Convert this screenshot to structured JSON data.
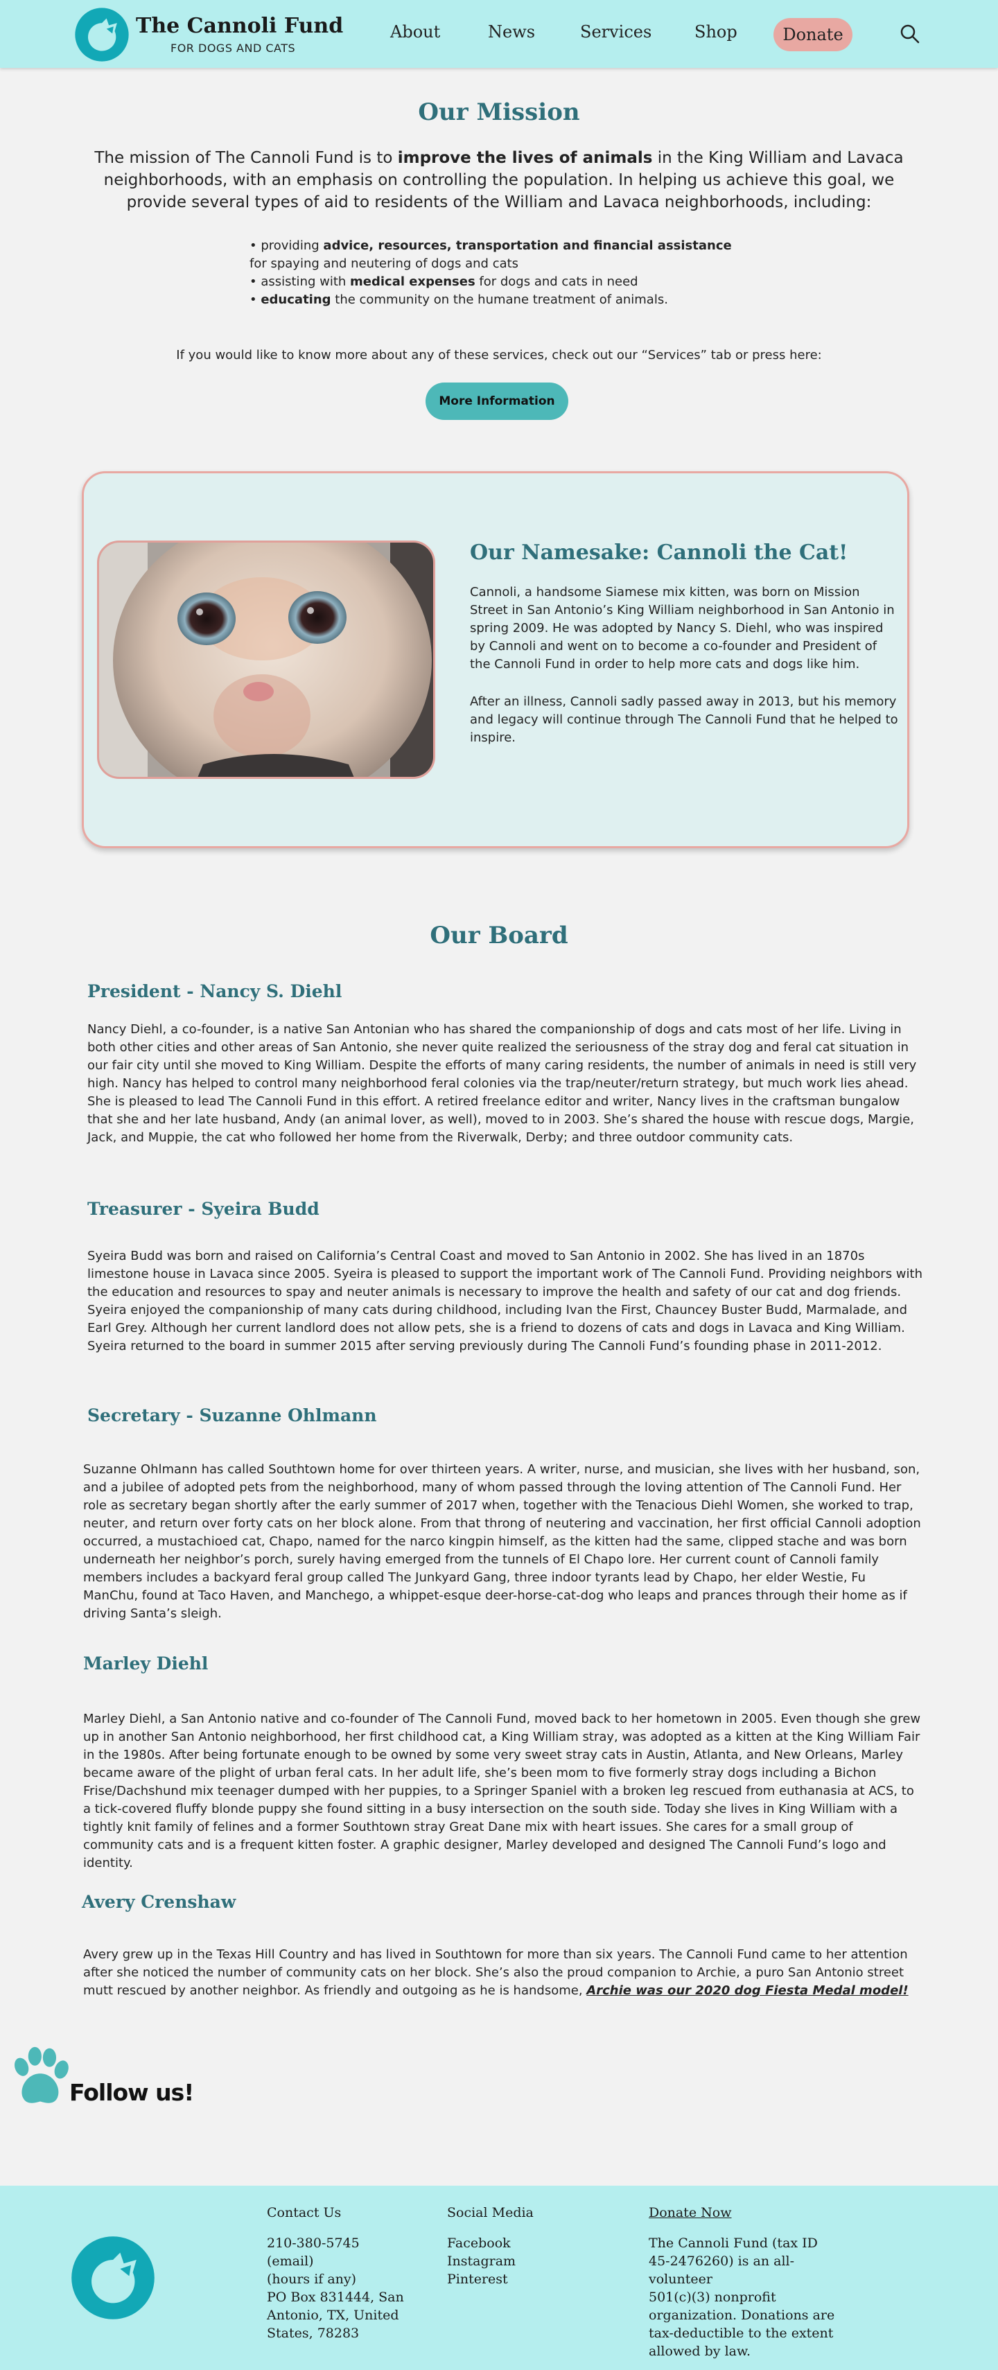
{
  "header": {
    "brand_title": "The Cannoli Fund",
    "brand_subtitle": "FOR DOGS AND CATS",
    "nav": [
      "About",
      "News",
      "Services",
      "Shop"
    ],
    "donate_label": "Donate",
    "search_icon": "search-icon"
  },
  "mission": {
    "title": "Our Mission",
    "intro_pre": "The mission of The Cannoli Fund is to ",
    "intro_bold": "improve the lives of animals",
    "intro_post": " in the King William and Lavaca neighborhoods, with an emphasis on controlling the population. In helping us achieve this goal, we provide several types of aid to residents of the William and Lavaca neighborhoods, including:",
    "items": [
      {
        "pre": "• providing ",
        "bold": "advice, resources, transportation and financial assistance",
        "post": " for spaying and neutering of dogs and cats"
      },
      {
        "pre": "• assisting with ",
        "bold": "medical expenses",
        "post": " for dogs and cats in need"
      },
      {
        "pre": "• ",
        "bold": "educating",
        "post": " the community on the humane treatment of animals."
      }
    ],
    "cta_text": "If you would like to know more about any of these services, check out our “Services” tab or press here:",
    "button_label": "More Information"
  },
  "namesake": {
    "title": "Our Namesake: Cannoli the Cat!",
    "paragraph_1": "Cannoli, a handsome Siamese mix kitten, was born on Mission Street in San Antonio’s King William neighborhood in San Antonio in spring 2009. He was adopted by Nancy S. Diehl, who was inspired by Cannoli and went on to become a co-founder and President of the Cannoli Fund in order to help more cats and dogs like him.",
    "paragraph_2": "After an illness, Cannoli sadly passed away in 2013, but his memory and legacy will continue through The Cannoli Fund that he helped to inspire."
  },
  "board": {
    "title": "Our Board",
    "members": [
      {
        "name": "President - Nancy S. Diehl",
        "bio": "Nancy Diehl, a co-founder, is a native San Antonian who has shared the companionship of dogs and cats most of her life. Living in both other cities and other areas of San Antonio, she never quite realized the seriousness of the stray dog and feral cat situation in our fair city until she moved to King William. Despite the efforts of many caring residents, the number of animals in need is still very high. Nancy has helped to control many neighborhood feral colonies via the trap/neuter/return strategy, but much work lies ahead. She is pleased to lead The Cannoli Fund in this effort. A retired freelance editor and writer, Nancy lives in the craftsman bungalow that she and her late husband, Andy (an animal lover, as well), moved to in 2003. She’s shared the house with rescue dogs, Margie,  Jack, and Muppie, the cat who followed her home from the Riverwalk, Derby; and three outdoor community cats."
      },
      {
        "name": "Treasurer - Syeira Budd",
        "bio": "Syeira Budd was born and raised on California’s Central Coast and moved to San Antonio in 2002. She has lived in an 1870s limestone house in Lavaca since 2005. Syeira is pleased to support the important work of The Cannoli Fund. Providing neighbors with the education and resources to spay and neuter animals is necessary to improve the health and safety of our cat and dog friends. Syeira enjoyed the companionship of many cats during childhood, including Ivan the First, Chauncey Buster Budd, Marmalade, and Earl Grey. Although her current landlord does not allow pets, she is a friend to dozens of cats and dogs in Lavaca and King William. Syeira returned to the board in summer 2015 after serving previously during The Cannoli Fund’s founding phase in 2011-2012."
      },
      {
        "name": "Secretary - Suzanne Ohlmann",
        "bio": "Suzanne Ohlmann has called Southtown home for over thirteen years. A writer, nurse, and musician, she lives with her husband, son, and a jubilee of adopted pets from the neighborhood, many of whom passed through the loving attention of The Cannoli Fund. Her role as secretary began shortly after the early summer of 2017 when, together with the Tenacious Diehl Women, she worked to trap, neuter, and return over forty cats on her block alone. From that throng of neutering and vaccination, her first official Cannoli adoption occurred, a mustachioed cat, Chapo, named for the narco kingpin himself, as the kitten had the same, clipped stache and was born underneath her neighbor’s porch, surely having emerged from the tunnels of El Chapo lore. Her current count of Cannoli family members includes a backyard feral group called The Junkyard Gang, three indoor tyrants lead by Chapo, her elder Westie, Fu ManChu, found at Taco Haven, and Manchego, a whippet-esque deer-horse-cat-dog who leaps and prances through their home as if driving Santa’s sleigh."
      },
      {
        "name": "Marley Diehl",
        "bio": "Marley Diehl, a San Antonio native and co-founder of The Cannoli Fund, moved back to her hometown in 2005. Even though she grew up in another San Antonio neighborhood, her first childhood cat, a King William stray, was adopted as a kitten at the King William Fair in the 1980s. After being fortunate enough to be owned by some very sweet stray cats in Austin, Atlanta, and New Orleans, Marley became aware of the plight of urban feral cats. In her adult life, she’s been mom to five formerly stray dogs including a Bichon Frise/Dachshund mix teenager dumped with her puppies, to a Springer Spaniel with a broken leg rescued from euthanasia at ACS, to a tick-covered fluffy blonde puppy she found sitting in a busy intersection on the south side. Today she lives in King William with a tightly knit family of felines and a former Southtown stray Great Dane mix with heart issues. She cares for a small group of community cats and is a frequent kitten foster. A graphic designer, Marley developed and designed The Cannoli Fund’s logo and identity."
      },
      {
        "name": "Avery Crenshaw",
        "bio": "Avery grew up in the Texas Hill Country and has lived in Southtown for more than six years. The Cannoli Fund came to her attention after she noticed the number of community cats on her block. She’s also the proud companion to Archie, a puro San Antonio street mutt rescued by another neighbor. As friendly and outgoing as he is handsome, ",
        "link": "Archie was our 2020 dog Fiesta Medal model!"
      }
    ]
  },
  "follow": {
    "label": "Follow us!",
    "icon": "paw-icon"
  },
  "footer": {
    "contact_heading": "Contact Us",
    "contact_lines": [
      "210-380-5745",
      "(email)",
      "(hours if any)",
      "PO Box 831444, San",
      "Antonio, TX, United",
      "States, 78283"
    ],
    "social_heading": "Social Media",
    "social_links": [
      "Facebook",
      "Instagram",
      "Pinterest"
    ],
    "donate_heading": "Donate Now",
    "donate_lines": [
      "The Cannoli Fund (tax ID",
      "45-2476260) is an all-volunteer",
      "501(c)(3) nonprofit",
      "organization. Donations are",
      "tax-deductible to the extent",
      "allowed by law."
    ]
  },
  "colors": {
    "header_bg": "#b5eeee",
    "accent_teal": "#4db8b8",
    "heading_teal": "#2f6f7a",
    "donate_pink": "#e8a8a2",
    "logo_teal": "#12a8b6",
    "page_bg": "#f2f2f2"
  }
}
